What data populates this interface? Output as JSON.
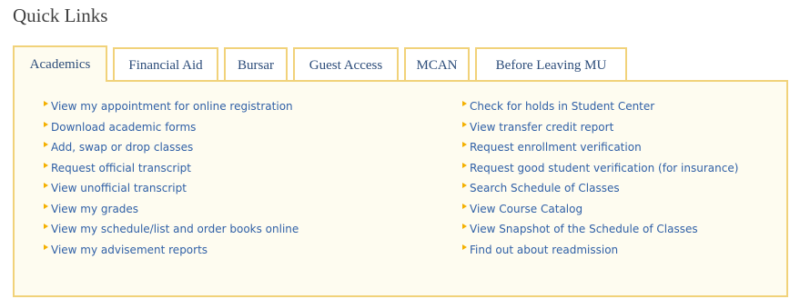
{
  "section": {
    "title": "Quick Links"
  },
  "tabs": [
    {
      "label": "Academics",
      "active": true
    },
    {
      "label": "Financial Aid",
      "active": false
    },
    {
      "label": "Bursar",
      "active": false
    },
    {
      "label": "Guest Access",
      "active": false
    },
    {
      "label": "MCAN",
      "active": false
    },
    {
      "label": "Before Leaving MU",
      "active": false
    }
  ],
  "links_left": [
    "View my appointment for online registration",
    "Download academic forms",
    "Add, swap or drop classes",
    "Request official transcript",
    "View unofficial transcript",
    "View my grades",
    "View my schedule/list and order books online",
    "View my advisement reports"
  ],
  "links_right": [
    "Check for holds in Student Center",
    "View transfer credit report",
    "Request enrollment verification",
    "Request good student verification (for insurance)",
    "Search Schedule of Classes",
    "View Course Catalog",
    "View Snapshot of the Schedule of Classes",
    "Find out about readmission"
  ],
  "colors": {
    "tab_border": "#f1d27a",
    "panel_bg": "#fefcf0",
    "link": "#3060a6",
    "bullet": "#f4b000",
    "tab_text": "#2d4d7a"
  },
  "icons": {
    "link_bullet": "orange-triangle-bullet-icon"
  }
}
